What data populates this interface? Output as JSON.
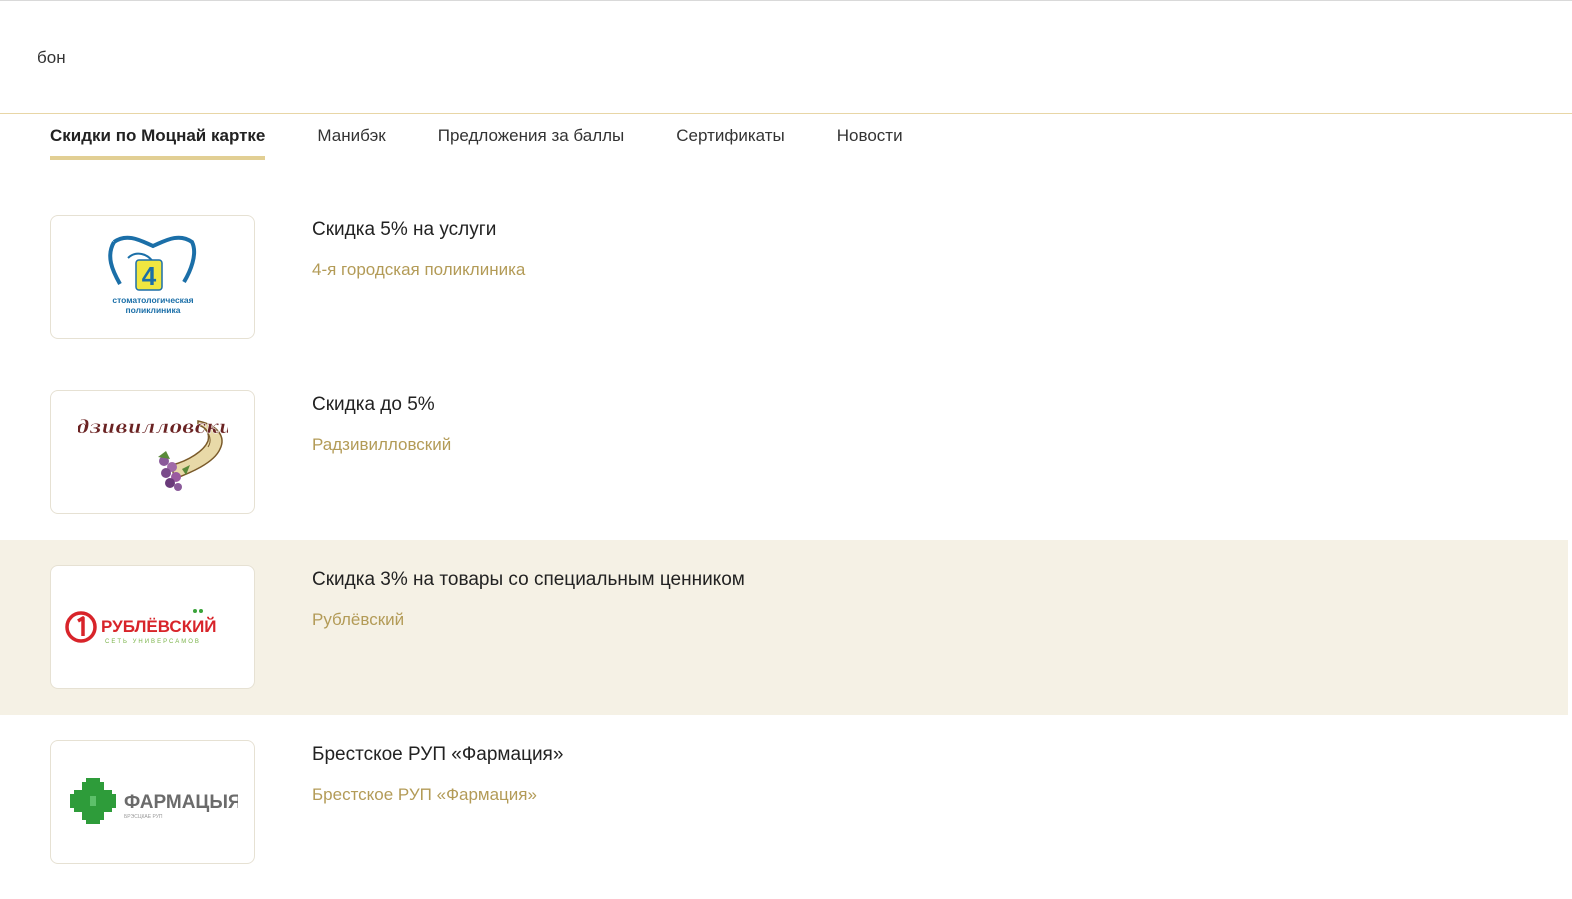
{
  "search": {
    "value": "бон"
  },
  "tabs": [
    {
      "label": "Скидки по Моцнай картке",
      "active": true
    },
    {
      "label": "Манибэк",
      "active": false
    },
    {
      "label": "Предложения за баллы",
      "active": false
    },
    {
      "label": "Сертификаты",
      "active": false
    },
    {
      "label": "Новости",
      "active": false
    }
  ],
  "offers": [
    {
      "title": "Скидка 5% на услуги",
      "partner": "4-я городская поликлиника",
      "logo": {
        "icon": "dental-clinic-logo-icon",
        "number": "4",
        "text_line1": "стоматологическая",
        "text_line2": "поликлиника"
      },
      "highlighted": false
    },
    {
      "title": "Скидка до 5%",
      "partner": "Радзивилловский",
      "logo": {
        "icon": "radzivillovsky-cornucopia-logo-icon",
        "text": "Радзивилловский"
      },
      "highlighted": false
    },
    {
      "title": "Скидка 3% на товары со специальным ценником",
      "partner": "Рублёвский",
      "logo": {
        "icon": "rublevsky-logo-icon",
        "text": "РУБЛЁВСКИЙ",
        "subtext": "СЕТЬ УНИВЕРСАМОВ"
      },
      "highlighted": true
    },
    {
      "title": "Брестское РУП «Фармация»",
      "partner": "Брестское РУП «Фармация»",
      "logo": {
        "icon": "pharmacy-cross-logo-icon",
        "text": "ФАРМАЦЫЯ",
        "subtext": "БРЭСЦКАЕ РУП"
      },
      "highlighted": false
    }
  ],
  "colors": {
    "accent": "#e2cf94",
    "partner_text": "#b39b57",
    "highlight_row": "#f5f1e5",
    "pharmacy_green": "#2e9c3a",
    "rublevsky_red": "#d8242a",
    "dental_blue": "#1b6fa8"
  }
}
